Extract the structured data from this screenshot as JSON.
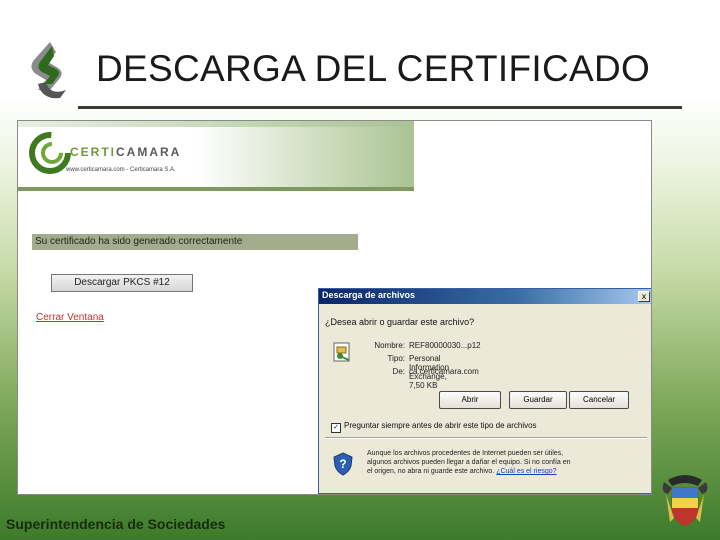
{
  "slide": {
    "title": "DESCARGA DEL CERTIFICADO",
    "footer": "Superintendencia de Sociedades"
  },
  "webpage": {
    "brand": {
      "part1": "CERTI",
      "part2": "CAMARA",
      "url": "www.certicamara.com - Certicamara S.A."
    },
    "success_message": "Su certificado ha sido generado correctamente",
    "download_button": "Descargar PKCS #12",
    "close_link": "Cerrar Ventana"
  },
  "dialog": {
    "title": "Descarga de archivos",
    "close_glyph": "x",
    "question": "¿Desea abrir o guardar este archivo?",
    "fields": [
      {
        "label": "Nombre:",
        "value": "REF80000030...p12"
      },
      {
        "label": "Tipo:",
        "value": "Personal Information Exchange, 7,50 KB"
      },
      {
        "label": "De:",
        "value": "ca.certicamara.com"
      }
    ],
    "buttons": {
      "open": "Abrir",
      "save": "Guardar",
      "cancel": "Cancelar"
    },
    "checkbox": {
      "label": "Preguntar siempre antes de abrir este tipo de archivos",
      "checked": true,
      "mark": "✓"
    },
    "warning": {
      "line1": "Aunque los archivos procedentes de Internet pueden ser útiles,",
      "line2": "algunos archivos pueden llegar a dañar el equipo. Si no confía en",
      "line3": "el origen, no abra ni guarde este archivo.",
      "link": "¿Cuál es el riesgo?"
    }
  },
  "icons": {
    "slide_logo": "supersociedades-logo-icon",
    "certicamara_logo": "certicamara-logo-icon",
    "file": "pfx-file-icon",
    "shield": "security-shield-icon",
    "emblem": "colombia-coat-of-arms-icon"
  },
  "colors": {
    "title_text": "#1a1a1a",
    "success_bar": "#a4ac8e",
    "close_link": "#c0342e",
    "dialog_title_bar": "#0a246a",
    "dialog_body": "#ece9d8",
    "brand_green": "#6e9b3a",
    "background_green": "#3c7a2a"
  }
}
